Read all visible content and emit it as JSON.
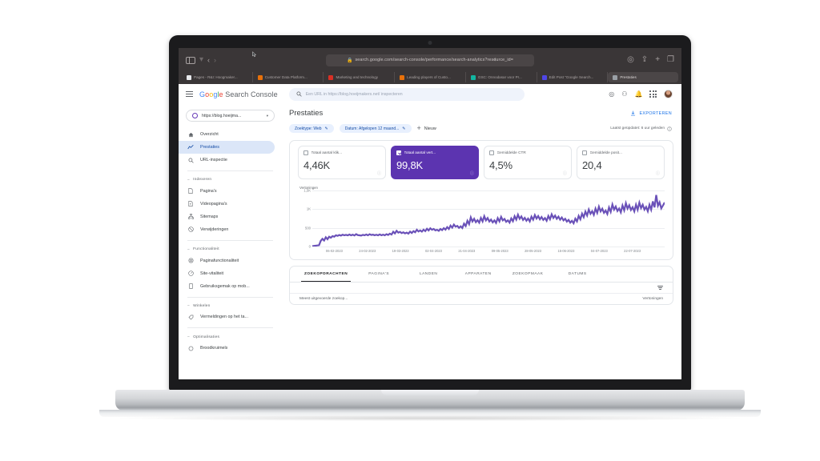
{
  "browser": {
    "url": "search.google.com/search-console/performance/search-analytics?resource_id=",
    "toolbar_icons": [
      "sidebar-toggle",
      "chevron-down",
      "back",
      "forward",
      "reader-mode",
      "lock",
      "shield",
      "extensions",
      "share",
      "new-tab",
      "tab-overview"
    ],
    "tabs": [
      {
        "label": "Pages - R&I: Hoogmaker...",
        "favicon": "#e8eaed",
        "active": false
      },
      {
        "label": "Customer Data Platform...",
        "favicon": "#e8710a",
        "active": false
      },
      {
        "label": "Marketing and technology",
        "favicon": "#d93025",
        "active": false
      },
      {
        "label": "Leading players of Custo...",
        "favicon": "#e8710a",
        "active": false
      },
      {
        "label": "GSC: Onnodasar voor Pr...",
        "favicon": "#12b5a0",
        "active": false
      },
      {
        "label": "Edit Post \"Google Search...",
        "favicon": "#4f46e5",
        "active": false
      },
      {
        "label": "Prestaties",
        "favicon": "#5f6368",
        "active": true
      }
    ]
  },
  "app": {
    "brand_g1": "G",
    "brand_o1": "o",
    "brand_o2": "o",
    "brand_g2": "g",
    "brand_l": "l",
    "brand_e": "e",
    "brand_rest": " Search Console",
    "search_placeholder": "Een URL in https://blog.hoeijmakers.net/ inspecteren",
    "header_icons": [
      "help-icon",
      "feedback-icon",
      "notifications-icon",
      "apps-grid-icon",
      "avatar"
    ]
  },
  "sidebar": {
    "property": "https://blog.hoeijma...",
    "items": [
      {
        "label": "Overzicht",
        "icon": "home-icon",
        "active": false
      },
      {
        "label": "Prestaties",
        "icon": "trending-up-icon",
        "active": true
      },
      {
        "label": "URL-inspectie",
        "icon": "search-icon",
        "active": false
      }
    ],
    "groups": [
      {
        "title": "Indexeren",
        "items": [
          {
            "label": "Pagina's",
            "icon": "page-icon"
          },
          {
            "label": "Videopagina's",
            "icon": "video-page-icon"
          },
          {
            "label": "Sitemaps",
            "icon": "sitemap-icon"
          },
          {
            "label": "Verwijderingen",
            "icon": "removals-icon"
          }
        ]
      },
      {
        "title": "Functionaliteit",
        "items": [
          {
            "label": "Paginafunctionaliteit",
            "icon": "gear-icon"
          },
          {
            "label": "Site-vitaliteit",
            "icon": "speedometer-icon"
          },
          {
            "label": "Gebruiksgemak op mob...",
            "icon": "mobile-icon"
          }
        ]
      },
      {
        "title": "Winkelen",
        "items": [
          {
            "label": "Vermeldingen op het ta...",
            "icon": "tag-icon"
          }
        ]
      },
      {
        "title": "Optimalisaties",
        "items": [
          {
            "label": "Broodkruimels",
            "icon": "breadcrumb-icon"
          }
        ]
      }
    ]
  },
  "main": {
    "page_title": "Prestaties",
    "export_label": "EXPORTEREN",
    "filters": [
      {
        "label": "Zoektype: Web",
        "editable": true
      },
      {
        "label": "Datum: Afgelopen 12 maand...",
        "editable": true
      }
    ],
    "new_filter_label": "Nieuw",
    "last_updated": "Laatst geüpdatet: 6 uur geleden",
    "metrics": [
      {
        "name": "Totaal aantal klik...",
        "value": "4,46K",
        "selected": false
      },
      {
        "name": "Totaal aantal vert...",
        "value": "99,8K",
        "selected": true
      },
      {
        "name": "Gemiddelde CTR",
        "value": "4,5%",
        "selected": false
      },
      {
        "name": "Gemiddelde posit...",
        "value": "20,4",
        "selected": false
      }
    ],
    "detail_tabs": [
      {
        "label": "ZOEKOPDRACHTEN",
        "active": true
      },
      {
        "label": "PAGINA'S",
        "active": false
      },
      {
        "label": "LANDEN",
        "active": false
      },
      {
        "label": "APPARATEN",
        "active": false
      },
      {
        "label": "ZOEKOPMAAK",
        "active": false
      },
      {
        "label": "DATUMS",
        "active": false
      }
    ],
    "table": {
      "col_left": "Meest uitgevoerde zoekop...",
      "col_right": "Vertoningen"
    }
  },
  "colors": {
    "accent_purple": "#5c34b0",
    "line_purple": "#6a51b8",
    "google_blue": "#1a73e8",
    "chip_blue_bg": "#e8f0fe",
    "active_nav_bg": "#dbe6f8"
  },
  "chart_data": {
    "type": "line",
    "title": "Vertoningen",
    "legend": "Vertoningen",
    "xlabel": "",
    "ylabel": "",
    "ylim": [
      0,
      1500
    ],
    "yticks": [
      0,
      500,
      1000,
      1500
    ],
    "ytick_labels": [
      "0",
      "500",
      "1K",
      "1,5K"
    ],
    "grid": true,
    "legend_position": "top-left",
    "xtick_labels": [
      "06-02-2023",
      "24-02-2023",
      "19-03-2023",
      "02-04-2023",
      "21-04-2023",
      "09-05-2023",
      "28-05-2023",
      "15-06-2023",
      "04-07-2023",
      "22-07-2023"
    ],
    "series": [
      {
        "name": "Vertoningen",
        "color": "#6a51b8",
        "values": [
          12,
          16,
          22,
          28,
          34,
          150,
          205,
          160,
          248,
          195,
          262,
          235,
          278,
          262,
          300,
          285,
          308,
          292,
          318,
          300,
          312,
          298,
          322,
          300,
          318,
          295,
          330,
          305,
          300,
          292,
          312,
          300,
          322,
          300,
          330,
          308,
          318,
          302,
          316,
          300,
          325,
          302,
          318,
          300,
          330,
          310,
          345,
          320,
          395,
          350,
          420,
          372,
          392,
          360,
          380,
          352,
          372,
          345,
          398,
          362,
          412,
          382,
          450,
          402,
          432,
          398,
          452,
          412,
          475,
          430,
          488,
          448,
          470,
          432,
          448,
          420,
          470,
          438,
          492,
          452,
          520,
          470,
          560,
          505,
          588,
          530,
          552,
          500,
          540,
          495,
          612,
          548,
          688,
          600,
          780,
          670,
          742,
          650,
          705,
          638,
          765,
          672,
          812,
          700,
          762,
          668,
          720,
          645,
          700,
          632,
          760,
          672,
          795,
          700,
          738,
          660,
          700,
          640,
          752,
          678,
          812,
          720,
          852,
          742,
          805,
          712,
          768,
          690,
          748,
          672,
          800,
          718,
          842,
          748,
          815,
          728,
          790,
          712,
          762,
          688,
          818,
          730,
          862,
          765,
          828,
          742,
          800,
          718,
          778,
          700,
          742,
          668,
          712,
          640,
          688,
          622,
          745,
          672,
          820,
          728,
          880,
          785,
          935,
          830,
          990,
          875,
          945,
          848,
          1015,
          900,
          1068,
          940,
          1012,
          902,
          962,
          870,
          1045,
          928,
          1125,
          988,
          1070,
          950,
          1018,
          915,
          1098,
          968,
          1160,
          1015,
          1105,
          978,
          1052,
          940,
          1120,
          985,
          1175,
          1030,
          1118,
          988,
          1060,
          945,
          1118,
          985,
          1210,
          1048,
          1378,
          1090,
          1185,
          1022,
          1098,
          1180
        ]
      }
    ]
  }
}
